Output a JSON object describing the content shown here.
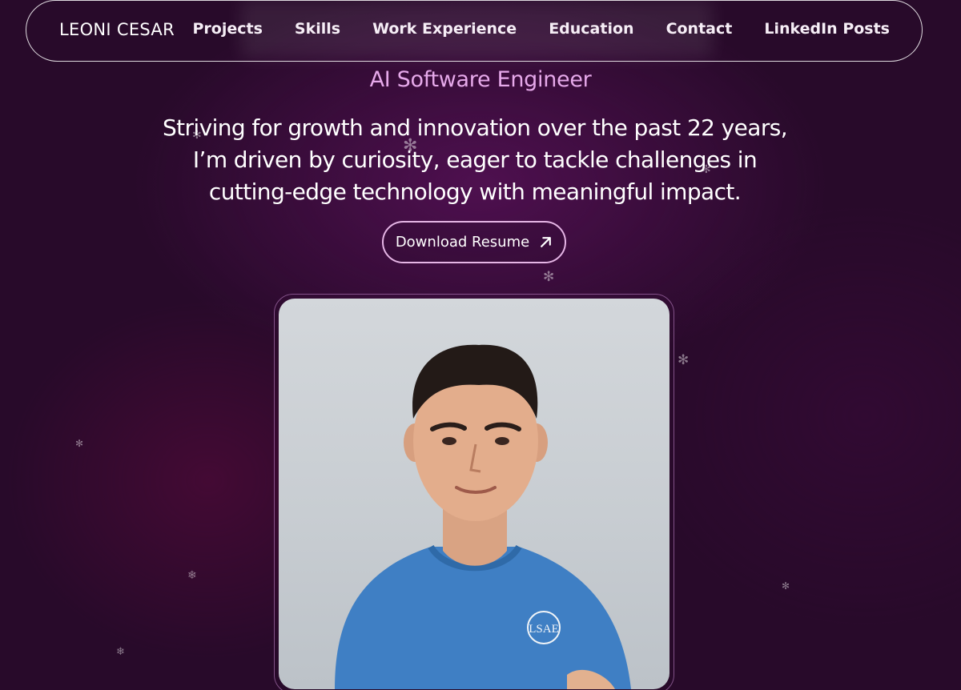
{
  "nav": {
    "brand": "LEONI CESAR",
    "links": [
      "Projects",
      "Skills",
      "Work Experience",
      "Education",
      "Contact",
      "LinkedIn Posts"
    ]
  },
  "hero": {
    "role": "AI Software Engineer",
    "tagline": "Striving for growth and innovation over the past 22 years, I’m driven by curiosity, eager to tackle challenges in cutting-edge technology with meaningful impact.",
    "resume_button": "Download Resume"
  },
  "shirt_logo": "LSAE",
  "colors": {
    "background": "#280a2a",
    "accent": "#e6a9ea",
    "button_border": "#e6b6e6",
    "shirt": "#3f7fc4"
  },
  "icons": {
    "resume_button": "arrow-up-right-icon",
    "decor": "snowflake-icon"
  }
}
